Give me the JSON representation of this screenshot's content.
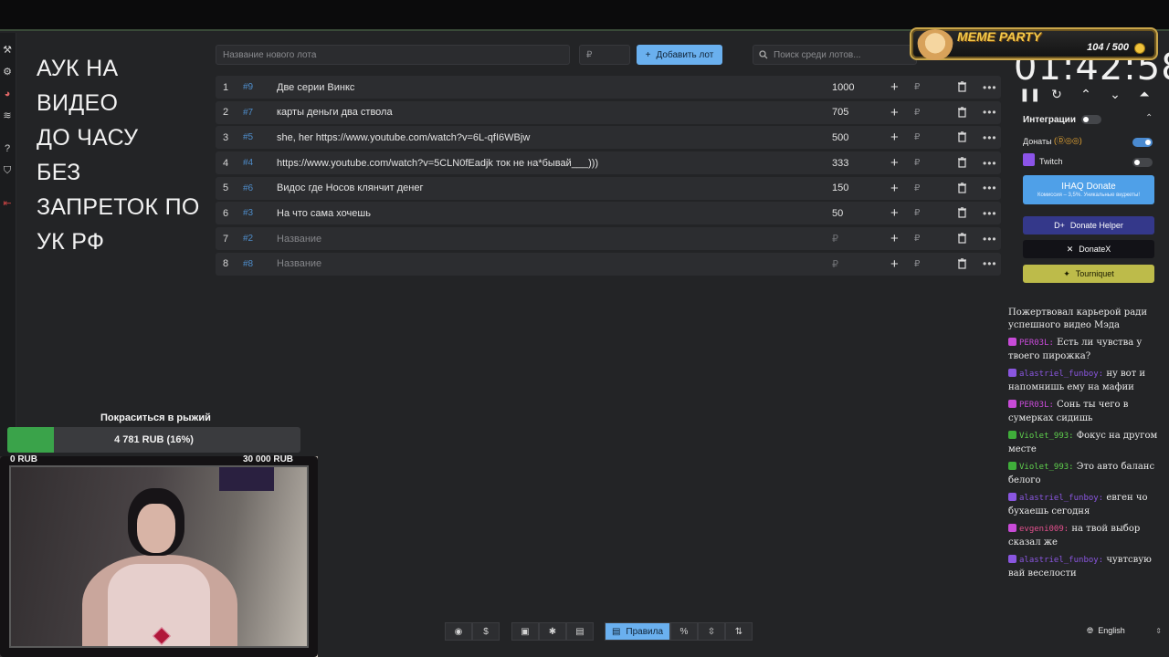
{
  "overlay": {
    "lines": [
      "АУК НА",
      "ВИДЕО",
      "ДО ЧАСУ",
      "БЕЗ",
      "ЗАПРЕТОК ПО",
      "УК РФ"
    ]
  },
  "toolbar": {
    "new_lot_placeholder": "Название нового лота",
    "amount_placeholder": "₽",
    "add_label": "Добавить лот",
    "search_placeholder": "Поиск среди лотов..."
  },
  "lots": [
    {
      "num": "1",
      "id": "#9",
      "name": "Две серии Винкс",
      "amount": "1000"
    },
    {
      "num": "2",
      "id": "#7",
      "name": "карты деньги два ствола",
      "amount": "705"
    },
    {
      "num": "3",
      "id": "#5",
      "name": "she, her https://www.youtube.com/watch?v=6L-qfI6WBjw",
      "amount": "500"
    },
    {
      "num": "4",
      "id": "#4",
      "name": "https://www.youtube.com/watch?v=5CLN0fEadjk ток не на*бывай___)))",
      "amount": "333"
    },
    {
      "num": "5",
      "id": "#6",
      "name": "Видос где Носов клянчит денег",
      "amount": "150"
    },
    {
      "num": "6",
      "id": "#3",
      "name": "На что сама хочешь",
      "amount": "50"
    },
    {
      "num": "7",
      "id": "#2",
      "name": "Название",
      "amount": "₽",
      "placeholder": true
    },
    {
      "num": "8",
      "id": "#8",
      "name": "Название",
      "amount": "₽",
      "placeholder": true
    }
  ],
  "currency_symbol": "₽",
  "badge": {
    "title": "MEME PARTY",
    "score": "104 / 500"
  },
  "timer": {
    "value": "01:42:58"
  },
  "integrations": {
    "title": "Интеграции",
    "donations_label": "Донаты",
    "twitch_label": "Twitch",
    "donations_enabled": true,
    "twitch_enabled": false,
    "iqdonate_label": "IHAQ Donate",
    "iqdonate_sub": "Комиссия – 3,5%. Уникальные виджеты!",
    "donatehelper_label": "Donate Helper",
    "donatex_label": "DonateX",
    "tourniquet_label": "Tourniquet"
  },
  "chat": [
    {
      "nick": "",
      "text": "Пожертвовал карьерой ради успешного видео Мэда",
      "color": ""
    },
    {
      "nick": "PER03L:",
      "text": "Есть ли чувства у твоего пирожка?",
      "color": "pink"
    },
    {
      "nick": "alastriel_funboy:",
      "text": "ну вот и напомнишь ему на мафии",
      "color": "violet"
    },
    {
      "nick": "PER03L:",
      "text": "Сонь ты чего в сумерках сидишь",
      "color": "pink"
    },
    {
      "nick": "Violet_993:",
      "text": "Фокус на другом месте",
      "color": "green"
    },
    {
      "nick": "Violet_993:",
      "text": "Это авто баланс белого",
      "color": "green"
    },
    {
      "nick": "alastriel_funboy:",
      "text": "евген чо бухаешь сегодня",
      "color": "violet"
    },
    {
      "nick": "evgeni009:",
      "text": "на твой выбор сказал же",
      "color": "red"
    },
    {
      "nick": "alastriel_funboy:",
      "text": "чувтсвую вай веселости",
      "color": "violet"
    }
  ],
  "goal": {
    "title": "Покраситься в рыжий",
    "progress_text": "4 781 RUB (16%)",
    "progress_fraction": 0.16,
    "min_label": "0 RUB",
    "max_label": "30 000 RUB"
  },
  "bottom": {
    "rules_label": "Правила"
  },
  "language": {
    "label": "English"
  }
}
